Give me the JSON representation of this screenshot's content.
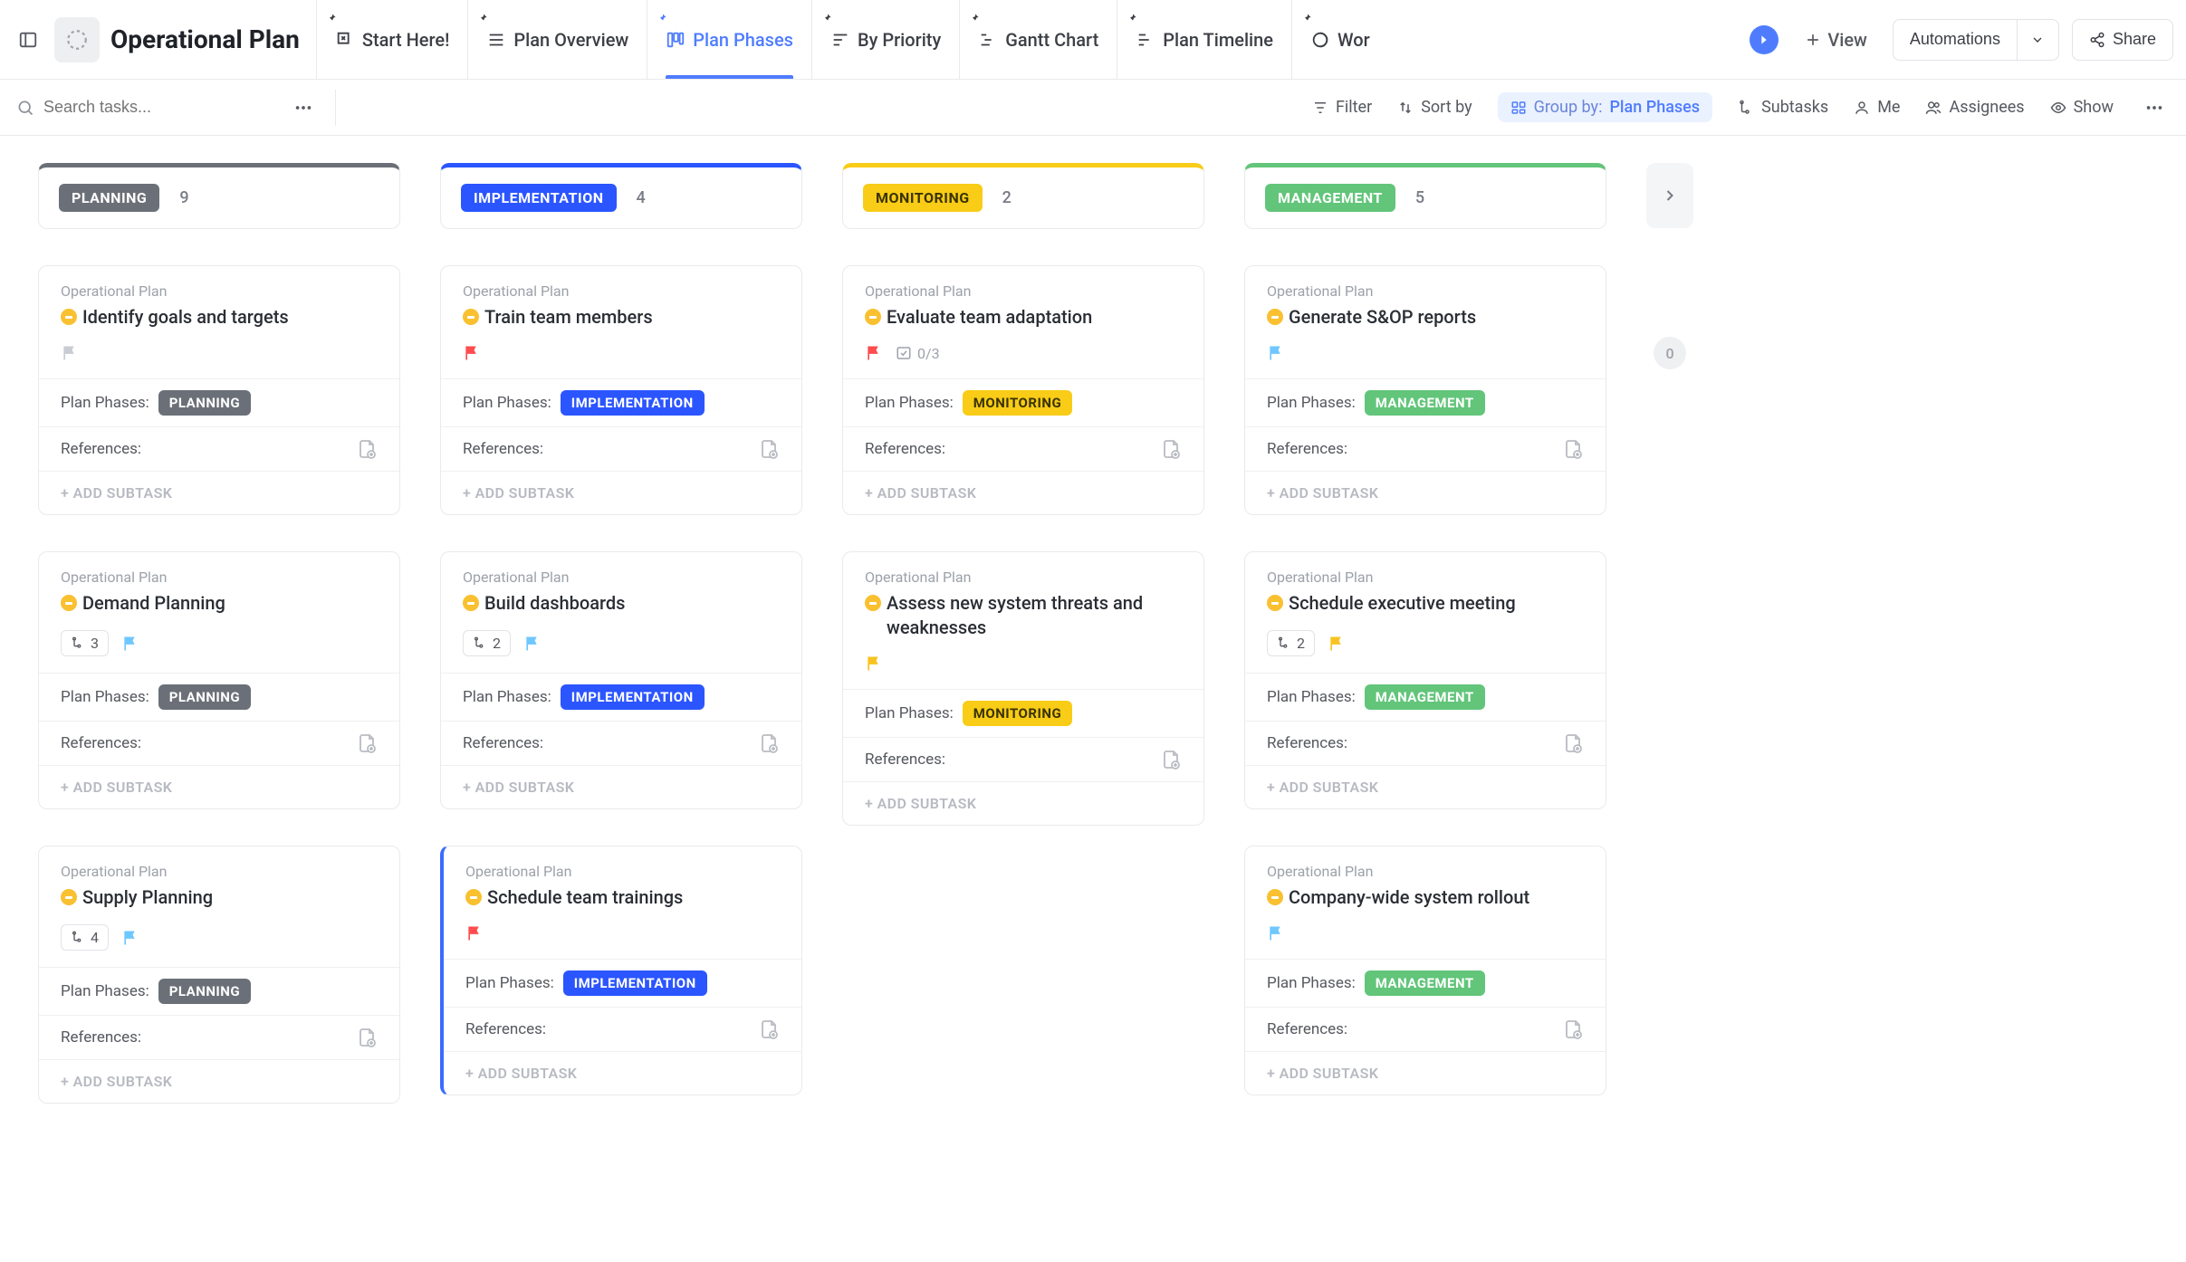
{
  "header": {
    "project_title": "Operational Plan",
    "tabs": [
      {
        "label": "Start Here!",
        "active": false
      },
      {
        "label": "Plan Overview",
        "active": false
      },
      {
        "label": "Plan Phases",
        "active": true
      },
      {
        "label": "By Priority",
        "active": false
      },
      {
        "label": "Gantt Chart",
        "active": false
      },
      {
        "label": "Plan Timeline",
        "active": false
      },
      {
        "label": "Wor",
        "active": false
      }
    ],
    "add_view_label": "View",
    "automations_label": "Automations",
    "share_label": "Share"
  },
  "toolbar": {
    "search_placeholder": "Search tasks...",
    "filter_label": "Filter",
    "sort_label": "Sort by",
    "group_prefix": "Group by:",
    "group_value": "Plan Phases",
    "subtasks_label": "Subtasks",
    "me_label": "Me",
    "assignees_label": "Assignees",
    "show_label": "Show"
  },
  "labels": {
    "list_name": "Operational Plan",
    "plan_phases": "Plan Phases:",
    "references": "References:",
    "add_subtask": "+ ADD SUBTASK"
  },
  "columns": [
    {
      "key": "planning",
      "label": "PLANNING",
      "count": "9"
    },
    {
      "key": "implementation",
      "label": "IMPLEMENTATION",
      "count": "4"
    },
    {
      "key": "monitoring",
      "label": "MONITORING",
      "count": "2"
    },
    {
      "key": "management",
      "label": "MANAGEMENT",
      "count": "5"
    }
  ],
  "extra_count": "0",
  "cards": {
    "planning": [
      {
        "title": "Identify goals and targets",
        "flag": "grey",
        "subtasks": null,
        "checks": null,
        "phase": "PLANNING"
      },
      {
        "title": "Demand Planning",
        "flag": "sky",
        "subtasks": "3",
        "checks": null,
        "phase": "PLANNING"
      },
      {
        "title": "Supply Planning",
        "flag": "sky",
        "subtasks": "4",
        "checks": null,
        "phase": "PLANNING"
      }
    ],
    "implementation": [
      {
        "title": "Train team members",
        "flag": "red",
        "subtasks": null,
        "checks": null,
        "phase": "IMPLEMENTATION"
      },
      {
        "title": "Build dashboards",
        "flag": "sky",
        "subtasks": "2",
        "checks": null,
        "phase": "IMPLEMENTATION"
      },
      {
        "title": "Schedule team trainings",
        "flag": "red",
        "subtasks": null,
        "checks": null,
        "phase": "IMPLEMENTATION",
        "selected": true
      }
    ],
    "monitoring": [
      {
        "title": "Evaluate team adaptation",
        "flag": "red",
        "subtasks": null,
        "checks": "0/3",
        "phase": "MONITORING"
      },
      {
        "title": "Assess new system threats and weaknesses",
        "flag": "yellow",
        "subtasks": null,
        "checks": null,
        "phase": "MONITORING"
      }
    ],
    "management": [
      {
        "title": "Generate S&OP reports",
        "flag": "sky",
        "subtasks": null,
        "checks": null,
        "phase": "MANAGEMENT"
      },
      {
        "title": "Schedule executive meeting",
        "flag": "yellow",
        "subtasks": "2",
        "checks": null,
        "phase": "MANAGEMENT"
      },
      {
        "title": "Company-wide system rollout",
        "flag": "sky",
        "subtasks": null,
        "checks": null,
        "phase": "MANAGEMENT"
      }
    ]
  },
  "flag_colors": {
    "grey": "#c9ccd2",
    "sky": "#6fc7ff",
    "red": "#ff4d4f",
    "yellow": "#f8c321"
  },
  "phase_styles": {
    "PLANNING": "chip-planning",
    "IMPLEMENTATION": "chip-implementation",
    "MONITORING": "chip-monitoring",
    "MANAGEMENT": "chip-management"
  }
}
